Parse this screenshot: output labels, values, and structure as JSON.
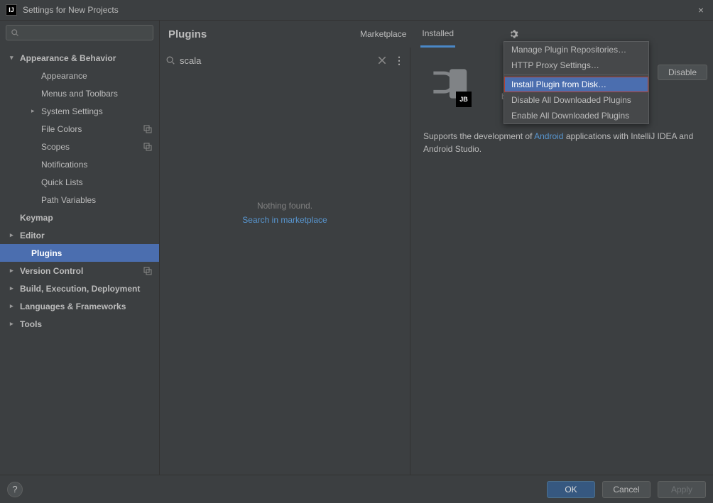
{
  "window": {
    "title": "Settings for New Projects"
  },
  "sidebar": {
    "items": [
      {
        "label": "Appearance & Behavior",
        "bold": true,
        "arrow": "▾"
      },
      {
        "label": "Appearance",
        "child": true
      },
      {
        "label": "Menus and Toolbars",
        "child": true
      },
      {
        "label": "System Settings",
        "child": true,
        "arrow": "▸"
      },
      {
        "label": "File Colors",
        "child": true,
        "copy": true
      },
      {
        "label": "Scopes",
        "child": true,
        "copy": true
      },
      {
        "label": "Notifications",
        "child": true
      },
      {
        "label": "Quick Lists",
        "child": true
      },
      {
        "label": "Path Variables",
        "child": true
      },
      {
        "label": "Keymap",
        "bold": true
      },
      {
        "label": "Editor",
        "bold": true,
        "arrow": "▸"
      },
      {
        "label": "Plugins",
        "bold": true,
        "selected": true
      },
      {
        "label": "Version Control",
        "bold": true,
        "arrow": "▸",
        "copy": true
      },
      {
        "label": "Build, Execution, Deployment",
        "bold": true,
        "arrow": "▸"
      },
      {
        "label": "Languages & Frameworks",
        "bold": true,
        "arrow": "▸"
      },
      {
        "label": "Tools",
        "bold": true,
        "arrow": "▸"
      }
    ]
  },
  "content": {
    "heading": "Plugins",
    "tabs": {
      "marketplace": "Marketplace",
      "installed": "Installed"
    },
    "search": {
      "value": "scala"
    },
    "empty": {
      "nothing": "Nothing found.",
      "link": "Search in marketplace"
    }
  },
  "plugin": {
    "bundled": "bundled",
    "disable": "Disable",
    "desc_pre": "Supports the development of ",
    "desc_link": "Android",
    "desc_post": " applications with IntelliJ IDEA and Android Studio."
  },
  "dropdown": {
    "repos": "Manage Plugin Repositories…",
    "proxy": "HTTP Proxy Settings…",
    "install": "Install Plugin from Disk…",
    "disable_all": "Disable All Downloaded Plugins",
    "enable_all": "Enable All Downloaded Plugins"
  },
  "footer": {
    "help": "?",
    "ok": "OK",
    "cancel": "Cancel",
    "apply": "Apply"
  }
}
